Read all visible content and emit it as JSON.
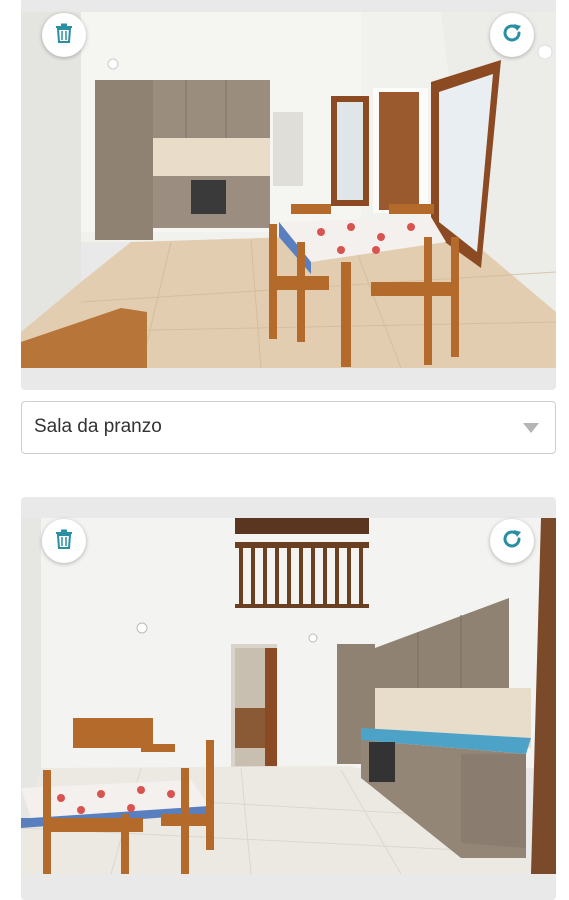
{
  "photos": [
    {
      "room_select": {
        "value": "Sala da pranzo"
      },
      "icons": {
        "delete": "trash-icon",
        "rotate": "rotate-icon"
      }
    },
    {
      "icons": {
        "delete": "trash-icon",
        "rotate": "rotate-icon"
      }
    }
  ],
  "colors": {
    "accent": "#2a8fa3",
    "card_bg": "#e9e9e9",
    "field_border": "#cfcfcf"
  }
}
